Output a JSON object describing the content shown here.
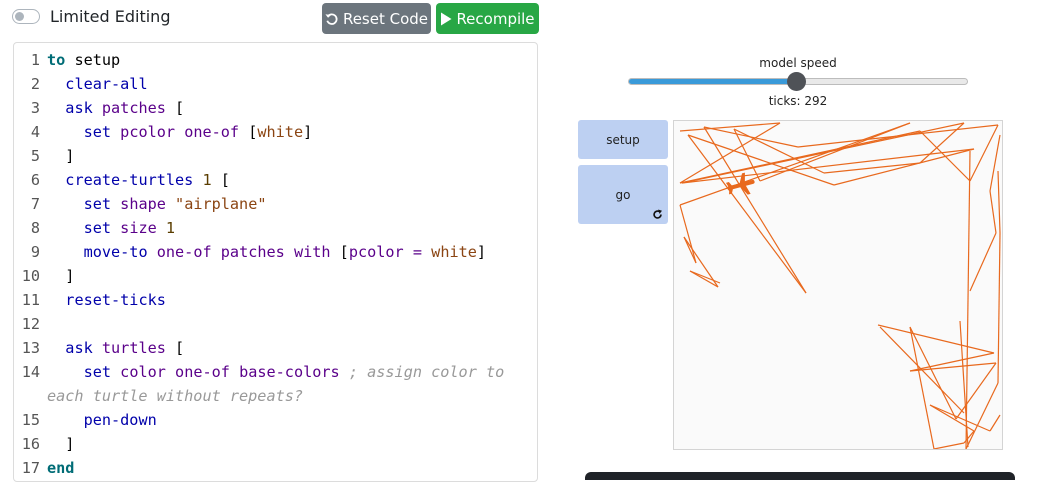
{
  "toolbar": {
    "limited_editing_label": "Limited Editing",
    "limited_editing_on": false,
    "reset_code_label": "Reset Code",
    "recompile_label": "Recompile"
  },
  "code": {
    "lines": [
      {
        "n": "1",
        "tokens": [
          [
            "kw-proc",
            "to"
          ],
          [
            "plain",
            " setup"
          ]
        ]
      },
      {
        "n": "2",
        "tokens": [
          [
            "plain",
            "  "
          ],
          [
            "kw",
            "clear-all"
          ]
        ]
      },
      {
        "n": "3",
        "tokens": [
          [
            "plain",
            "  "
          ],
          [
            "kw",
            "ask"
          ],
          [
            "plain",
            " "
          ],
          [
            "prim",
            "patches"
          ],
          [
            "plain",
            " ["
          ]
        ]
      },
      {
        "n": "4",
        "tokens": [
          [
            "plain",
            "    "
          ],
          [
            "kw",
            "set"
          ],
          [
            "plain",
            " "
          ],
          [
            "prim",
            "pcolor"
          ],
          [
            "plain",
            " "
          ],
          [
            "prim",
            "one-of"
          ],
          [
            "plain",
            " ["
          ],
          [
            "const",
            "white"
          ],
          [
            "plain",
            "]"
          ]
        ]
      },
      {
        "n": "5",
        "tokens": [
          [
            "plain",
            "  ]"
          ]
        ]
      },
      {
        "n": "6",
        "tokens": [
          [
            "plain",
            "  "
          ],
          [
            "kw",
            "create-turtles"
          ],
          [
            "plain",
            " "
          ],
          [
            "num",
            "1"
          ],
          [
            "plain",
            " ["
          ]
        ]
      },
      {
        "n": "7",
        "tokens": [
          [
            "plain",
            "    "
          ],
          [
            "kw",
            "set"
          ],
          [
            "plain",
            " "
          ],
          [
            "prim",
            "shape"
          ],
          [
            "plain",
            " "
          ],
          [
            "const",
            "\"airplane\""
          ]
        ]
      },
      {
        "n": "8",
        "tokens": [
          [
            "plain",
            "    "
          ],
          [
            "kw",
            "set"
          ],
          [
            "plain",
            " "
          ],
          [
            "prim",
            "size"
          ],
          [
            "plain",
            " "
          ],
          [
            "num",
            "1"
          ]
        ]
      },
      {
        "n": "9",
        "tokens": [
          [
            "plain",
            "    "
          ],
          [
            "kw",
            "move-to"
          ],
          [
            "plain",
            " "
          ],
          [
            "prim",
            "one-of"
          ],
          [
            "plain",
            " "
          ],
          [
            "prim",
            "patches"
          ],
          [
            "plain",
            " "
          ],
          [
            "prim",
            "with"
          ],
          [
            "plain",
            " ["
          ],
          [
            "prim",
            "pcolor"
          ],
          [
            "plain",
            " "
          ],
          [
            "prim",
            "="
          ],
          [
            "plain",
            " "
          ],
          [
            "const",
            "white"
          ],
          [
            "plain",
            "]"
          ]
        ]
      },
      {
        "n": "10",
        "tokens": [
          [
            "plain",
            "  ]"
          ]
        ]
      },
      {
        "n": "11",
        "tokens": [
          [
            "plain",
            "  "
          ],
          [
            "kw",
            "reset-ticks"
          ]
        ]
      },
      {
        "n": "12",
        "tokens": []
      },
      {
        "n": "13",
        "tokens": [
          [
            "plain",
            "  "
          ],
          [
            "kw",
            "ask"
          ],
          [
            "plain",
            " "
          ],
          [
            "prim",
            "turtles"
          ],
          [
            "plain",
            " ["
          ]
        ]
      },
      {
        "n": "14",
        "tokens": [
          [
            "plain",
            "    "
          ],
          [
            "kw",
            "set"
          ],
          [
            "plain",
            " "
          ],
          [
            "prim",
            "color"
          ],
          [
            "plain",
            " "
          ],
          [
            "prim",
            "one-of"
          ],
          [
            "plain",
            " "
          ],
          [
            "prim",
            "base-colors"
          ],
          [
            "plain",
            " "
          ],
          [
            "cmt",
            "; assign color to"
          ]
        ]
      },
      {
        "n": "",
        "tokens": [
          [
            "cmt",
            "each turtle without repeats?"
          ]
        ]
      },
      {
        "n": "15",
        "tokens": [
          [
            "plain",
            "    "
          ],
          [
            "kw",
            "pen-down"
          ]
        ]
      },
      {
        "n": "16",
        "tokens": [
          [
            "plain",
            "  ]"
          ]
        ]
      },
      {
        "n": "17",
        "tokens": [
          [
            "kw-proc",
            "end"
          ]
        ]
      }
    ]
  },
  "model": {
    "speed_label": "model speed",
    "speed_value": 0.5,
    "ticks_label": "ticks: 292"
  },
  "buttons": {
    "setup_label": "setup",
    "go_label": "go"
  },
  "world": {
    "pen_color": "#e8691e",
    "turtle_shape": "airplane"
  },
  "colors": {
    "reset_button": "#6c757d",
    "recompile_button": "#28a745",
    "slider_fill": "#3a9ad9",
    "netlogo_button": "#bdd0f2",
    "pen": "#e8691e"
  }
}
